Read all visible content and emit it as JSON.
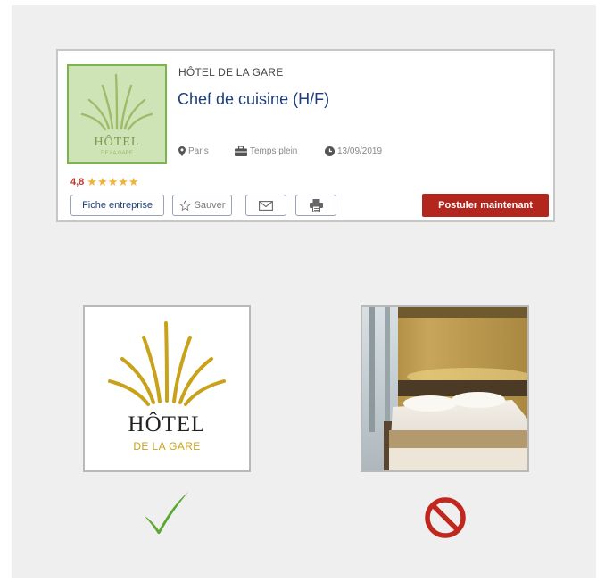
{
  "job_card": {
    "logo": {
      "line1": "HÔTEL",
      "line2": "DE LA GARE"
    },
    "company": "HÔTEL DE LA GARE",
    "title": "Chef de cuisine (H/F)",
    "meta": {
      "location": "Paris",
      "contract": "Temps plein",
      "date": "13/09/2019",
      "location_icon": "map-pin-icon",
      "contract_icon": "briefcase-icon",
      "date_icon": "clock-icon"
    },
    "rating": {
      "value": "4,8",
      "stars": "★★★★★",
      "star_count": 5
    },
    "buttons": {
      "company_page": "Fiche entreprise",
      "save": "Sauver",
      "save_icon": "star-outline-icon",
      "email_icon": "envelope-icon",
      "print_icon": "printer-icon",
      "apply": "Postuler maintenant"
    }
  },
  "comparison": {
    "good_example": {
      "line1": "HÔTEL",
      "line2": "DE LA GARE",
      "indicator": "checkmark-icon"
    },
    "bad_example": {
      "indicator": "prohibited-icon"
    }
  },
  "colors": {
    "brand_blue": "#1d3e7a",
    "apply_red": "#b3261e",
    "logo_gold": "#c9a21a",
    "logo_green_bg": "#cfe4b6",
    "check_green": "#5aa832",
    "prohibited_red": "#c0281f"
  }
}
